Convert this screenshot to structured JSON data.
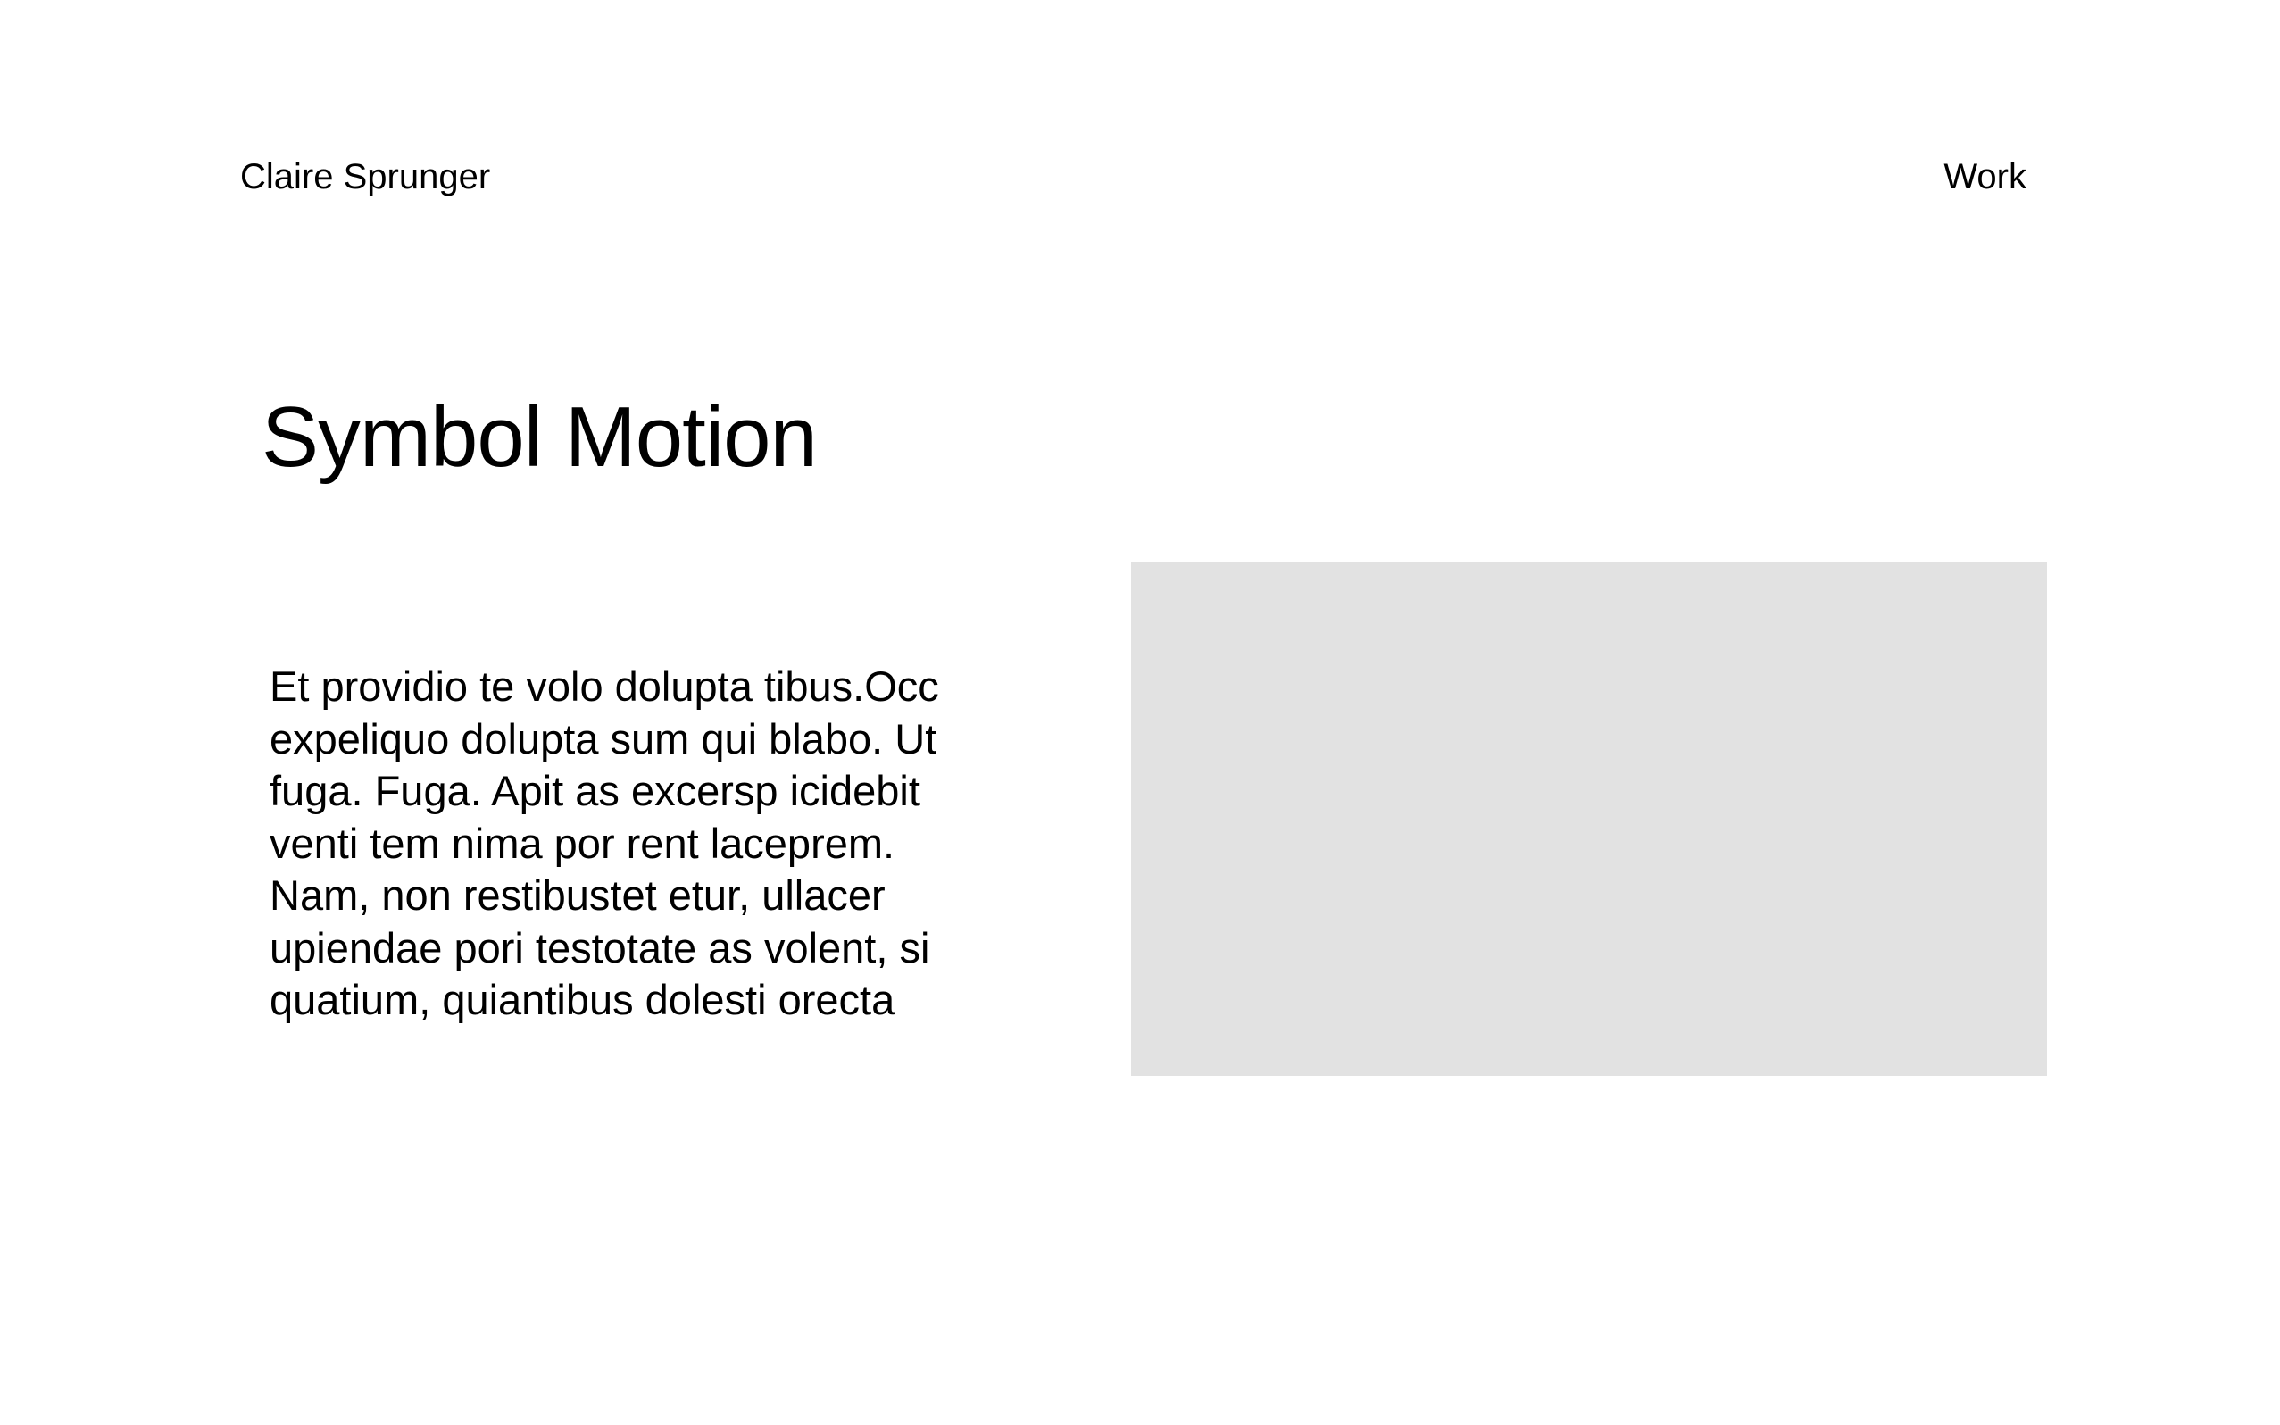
{
  "header": {
    "site_name": "Claire Sprunger",
    "nav_work": "Work"
  },
  "main": {
    "title": "Symbol Motion",
    "description": "Et providio te volo dolupta tibus.Occ expeliquo dolupta sum qui blabo. Ut fuga. Fuga. Apit as excersp icidebit venti tem nima por rent laceprem. Nam, non restibustet etur, ullacer upiendae pori testotate as volent, si quatium, quiantibus dolesti orecta"
  },
  "colors": {
    "background": "#ffffff",
    "text": "#000000",
    "placeholder": "#e2e2e2"
  }
}
